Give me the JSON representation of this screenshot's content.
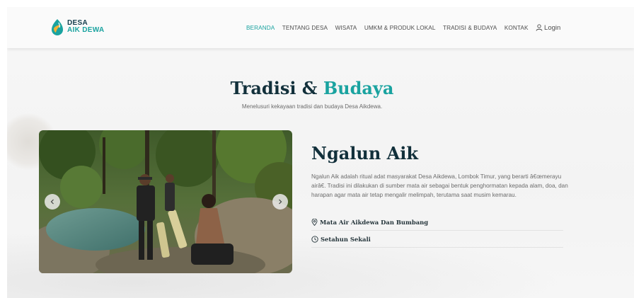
{
  "brand": {
    "line1": "DESA",
    "line2": "AIK DEWA"
  },
  "nav": {
    "items": [
      "BERANDA",
      "TENTANG DESA",
      "WISATA",
      "UMKM & PRODUK LOKAL",
      "TRADISI & BUDAYA",
      "KONTAK"
    ],
    "active": "BERANDA",
    "login": "Login"
  },
  "page": {
    "title_part1": "Tradisi &",
    "title_part2": "Budaya",
    "subtitle": "Menelusuri kekayaan tradisi dan budaya Desa Aikdewa."
  },
  "tradition": {
    "name": "Ngalun Aik",
    "description": "Ngalun Aik adalah ritual adat masyarakat Desa Aikdewa, Lombok Timur, yang berarti â€œmerayu airâ€. Tradisi ini dilakukan di sumber mata air sebagai bentuk penghormatan kepada alam, doa, dan harapan agar mata air tetap mengalir melimpah, terutama saat musim kemarau.",
    "location": "Mata Air Aikdewa Dan Bumbang",
    "frequency": "Setahun Sekali"
  },
  "colors": {
    "accent": "#1aa3a0",
    "dark": "#12303b"
  },
  "icons": {
    "login": "user-icon",
    "location": "map-pin-icon",
    "time": "clock-icon",
    "prev": "chevron-left-icon",
    "next": "chevron-right-icon"
  }
}
